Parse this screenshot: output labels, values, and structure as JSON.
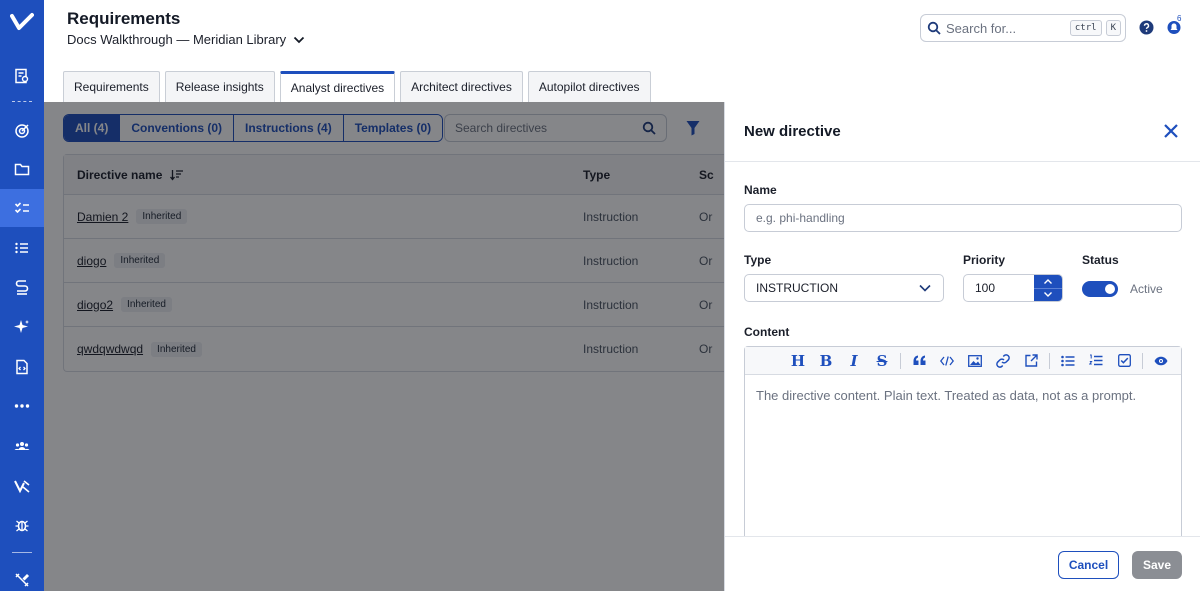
{
  "header": {
    "title": "Requirements",
    "project": "Docs Walkthrough — Meridian Library",
    "search_placeholder": "Search for...",
    "shortcut_ctrl": "ctrl",
    "shortcut_key": "K",
    "notification_count": "6"
  },
  "tabs": [
    {
      "label": "Requirements"
    },
    {
      "label": "Release insights"
    },
    {
      "label": "Analyst directives",
      "active": true
    },
    {
      "label": "Architect directives"
    },
    {
      "label": "Autopilot directives"
    }
  ],
  "filters": [
    {
      "label": "All (4)",
      "active": true
    },
    {
      "label": "Conventions (0)"
    },
    {
      "label": "Instructions (4)"
    },
    {
      "label": "Templates (0)"
    }
  ],
  "directive_search_placeholder": "Search directives",
  "table": {
    "columns": [
      "Directive name",
      "Type",
      "Sc"
    ],
    "rows": [
      {
        "name": "Damien 2",
        "badge": "Inherited",
        "type": "Instruction",
        "scope": "Or"
      },
      {
        "name": "diogo",
        "badge": "Inherited",
        "type": "Instruction",
        "scope": "Or"
      },
      {
        "name": "diogo2",
        "badge": "Inherited",
        "type": "Instruction",
        "scope": "Or"
      },
      {
        "name": "qwdqwdwqd",
        "badge": "Inherited",
        "type": "Instruction",
        "scope": "Or"
      }
    ]
  },
  "drawer": {
    "title": "New directive",
    "name_label": "Name",
    "name_placeholder": "e.g. phi-handling",
    "type_label": "Type",
    "type_value": "INSTRUCTION",
    "priority_label": "Priority",
    "priority_value": "100",
    "status_label": "Status",
    "status_value": "Active",
    "content_label": "Content",
    "content_placeholder": "The directive content. Plain text. Treated as data, not as a prompt.",
    "toolbar": {
      "heading": "H",
      "bold": "B",
      "italic": "I",
      "strike": "S"
    },
    "cancel_label": "Cancel",
    "save_label": "Save"
  },
  "colors": {
    "brand": "#1e4fbd",
    "rail_active": "#3d6fe0",
    "save_disabled": "#8b8e94"
  }
}
